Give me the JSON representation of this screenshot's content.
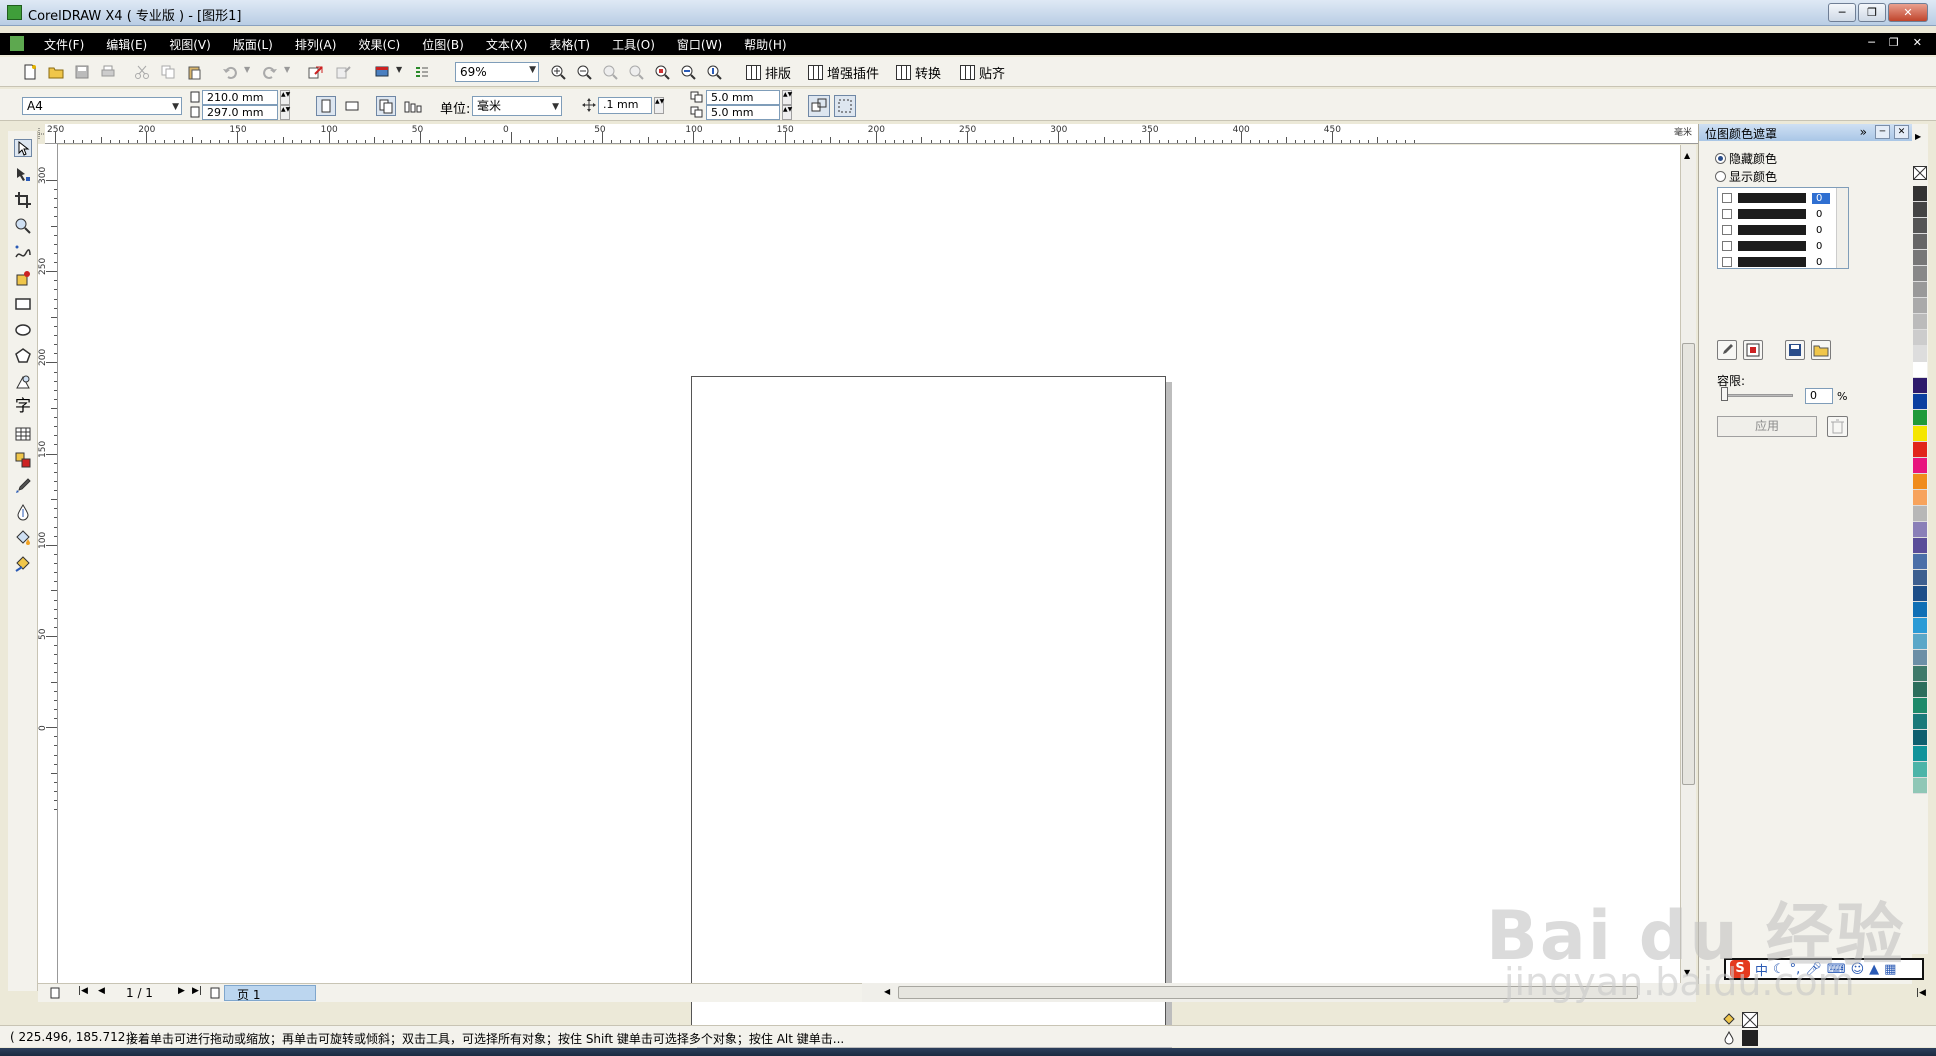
{
  "window": {
    "title": "CorelDRAW X4 ( 专业版 ) - [图形1]",
    "controls": [
      "─",
      "❐",
      "✕"
    ]
  },
  "menu": {
    "items": [
      "文件(F)",
      "编辑(E)",
      "视图(V)",
      "版面(L)",
      "排列(A)",
      "效果(C)",
      "位图(B)",
      "文本(X)",
      "表格(T)",
      "工具(O)",
      "窗口(W)",
      "帮助(H)"
    ],
    "mdi_controls": [
      "─",
      "❐",
      "✕"
    ]
  },
  "toolbar": {
    "zoom": "69%",
    "btn_layout": "排版",
    "btn_plugin": "增强插件",
    "btn_convert": "转换",
    "btn_snap": "贴齐"
  },
  "property_bar": {
    "paper_size": "A4",
    "width": "210.0 mm",
    "height": "297.0 mm",
    "unit_label": "单位:",
    "unit_value": "毫米",
    "nudge": ".1 mm",
    "dup_x": "5.0 mm",
    "dup_y": "5.0 mm"
  },
  "ruler": {
    "h_labels": [
      "250",
      "200",
      "150",
      "100",
      "50",
      "0",
      "50",
      "100",
      "150",
      "200",
      "250",
      "300",
      "350",
      "400",
      "450"
    ],
    "h_unit": "毫米",
    "v_labels": [
      "300",
      "250",
      "200",
      "150",
      "100",
      "50",
      "0"
    ]
  },
  "docker": {
    "title": "位图颜色遮罩",
    "radio_hide": "隐藏颜色",
    "radio_show": "显示颜色",
    "color_rows": [
      "0",
      "0",
      "0",
      "0",
      "0"
    ],
    "tolerance_label": "容限:",
    "tolerance_value": "0",
    "tolerance_unit": "%",
    "apply": "应用"
  },
  "navigator": {
    "page_count": "1 / 1",
    "page_tab": "页 1"
  },
  "status": {
    "coords": "( 225.496, 185.712 )",
    "hint": "接着单击可进行拖动或缩放；再单击可旋转或倾斜；双击工具，可选择所有对象；按住 Shift 键单击可选择多个对象；按住 Alt 键单击..."
  },
  "ime": {
    "logo": "S",
    "mode": "中"
  },
  "watermark": {
    "brand": "Bai du 经验",
    "url": "jingyan.baidu.com"
  },
  "palette_colors": [
    "#333333",
    "#444444",
    "#555555",
    "#666666",
    "#777777",
    "#888888",
    "#999999",
    "#aaaaaa",
    "#bbbbbb",
    "#cccccc",
    "#dddddd",
    "#ffffff",
    "#2e1a6b",
    "#0b3fa0",
    "#1f9a3a",
    "#f5e600",
    "#e1251b",
    "#e8157e",
    "#f08c1c",
    "#f7a35c",
    "#b7b7b7",
    "#8a7fb8",
    "#5a4d99",
    "#4b6fa8",
    "#3d5f8f",
    "#1d4e88",
    "#0f6fb5",
    "#2b9bd6",
    "#5aa7c8",
    "#6c8fa6",
    "#3f7a6a",
    "#2c6e5c",
    "#1e8a6a",
    "#1a7a7a",
    "#0f5f6f",
    "#11939a",
    "#4cb4a8",
    "#8fc7b6"
  ]
}
